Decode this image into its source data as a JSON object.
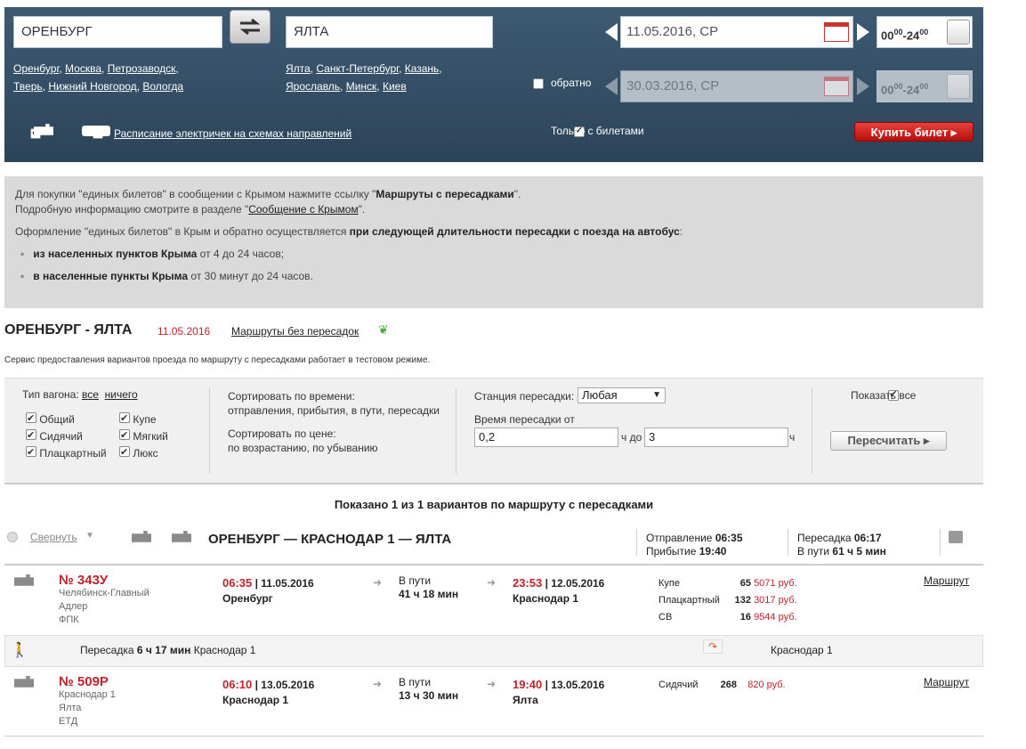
{
  "search": {
    "from": "ОРЕНБУРГ",
    "to": "ЯЛТА",
    "from_suggest_line1": [
      "Оренбург",
      "Москва",
      "Петрозаводск"
    ],
    "from_suggest_line2": [
      "Тверь",
      "Нижний Новгород",
      "Вологда"
    ],
    "to_suggest_line1": [
      "Ялта",
      "Санкт-Петербург",
      "Казань"
    ],
    "to_suggest_line2": [
      "Ярославль",
      "Минск",
      "Киев"
    ],
    "date_there": "11.05.2016, СР",
    "date_back": "30.03.2016, СР",
    "time_from_h": "00",
    "time_from_m": "00",
    "time_to_h": "24",
    "time_to_m": "00",
    "back_label": "обратно",
    "only_tickets_label": "Только с билетами",
    "suburban_link": "Расписание электричек на схемах направлений",
    "buy_button": "Купить билет"
  },
  "info": {
    "p1_start": "Для покупки \"единых билетов\" в сообщении с Крымом нажмите ссылку \"",
    "p1_bold": "Маршруты с пересадками",
    "p1_end": "\".",
    "p2_start": "Подробную информацию смотрите в разделе \"",
    "p2_link": "Сообщение с Крымом",
    "p2_end": "\".",
    "p3_start": "Оформление \"единых билетов\" в Крым и обратно осуществляется ",
    "p3_bold": "при следующей длительности пересадки с поезда на автобус",
    "p3_end": ":",
    "b1_bold": "из населенных пунктов Крыма",
    "b1_rest": " от 4 до 24 часов;",
    "b2_bold": "в населенные пункты Крыма",
    "b2_rest": " от 30 минут до 24 часов."
  },
  "route": {
    "title": "ОРЕНБУРГ - ЯЛТА",
    "date": "11.05.2016",
    "direct_link": "Маршруты без пересадок",
    "test_notice": "Сервис предоставления вариантов проезда по маршруту с пересадками работает в тестовом режиме."
  },
  "filters": {
    "car_type_label": "Тип вагона:",
    "all": "все",
    "none": "ничего",
    "types_col1": [
      "Общий",
      "Сидячий",
      "Плацкартный"
    ],
    "types_col2": [
      "Купе",
      "Мягкий",
      "Люкс"
    ],
    "sort_time_label": "Сортировать по времени:",
    "sort_time_opts": "отправления, прибытия, в пути, пересадки",
    "sort_price_label": "Сортировать по цене:",
    "sort_price_opts": "по возрастанию, по убыванию",
    "station_label": "Станция пересадки:",
    "station_value": "Любая",
    "transfer_time_label": "Время пересадки от",
    "transfer_from": "0,2",
    "transfer_unit_mid": "ч до",
    "transfer_to": "3",
    "transfer_unit_end": "ч",
    "show_all": "Показать все",
    "recalc": "Пересчитать"
  },
  "results": {
    "summary": "Показано 1 из 1 вариантов по маршруту с пересадками",
    "collapse": "Свернуть",
    "route_name": "ОРЕНБУРГ — КРАСНОДАР 1 — ЯЛТА",
    "dep_label": "Отправление",
    "dep_time": "06:35",
    "arr_label": "Прибытие",
    "arr_time": "19:40",
    "transfer_label": "Пересадка",
    "transfer_time": "06:17",
    "travel_label": "В пути",
    "travel_time": "61 ч 5 мин",
    "trains": [
      {
        "number": "№ 343У",
        "info": [
          "Челябинск-Главный",
          "Адлер",
          "ФПК"
        ],
        "dep_time": "06:35",
        "dep_date": "| 11.05.2016",
        "dep_station": "Оренбург",
        "travel_label": "В пути",
        "travel": "41 ч 18 мин",
        "arr_time": "23:53",
        "arr_date": "| 12.05.2016",
        "arr_station": "Краснодар 1",
        "seats": [
          {
            "type": "Купе",
            "count": "65",
            "price": "5071 руб."
          },
          {
            "type": "Плацкартный",
            "count": "132",
            "price": "3017 руб."
          },
          {
            "type": "СВ",
            "count": "16",
            "price": "9544 руб."
          }
        ],
        "route_link": "Маршрут"
      },
      {
        "number": "№ 509Р",
        "info": [
          "Краснодар 1",
          "Ялта",
          "ЕТД"
        ],
        "dep_time": "06:10",
        "dep_date": "| 13.05.2016",
        "dep_station": "Краснодар 1",
        "travel_label": "В пути",
        "travel": "13 ч 30 мин",
        "arr_time": "19:40",
        "arr_date": "| 13.05.2016",
        "arr_station": "Ялта",
        "seats": [
          {
            "type": "Сидячий",
            "count": "268",
            "price": "820 руб."
          }
        ],
        "route_link": "Маршрут"
      }
    ],
    "transfer_row": {
      "label": "Пересадка",
      "duration": "6 ч 17 мин",
      "station": "Краснодар 1",
      "station_right": "Краснодар 1"
    }
  }
}
